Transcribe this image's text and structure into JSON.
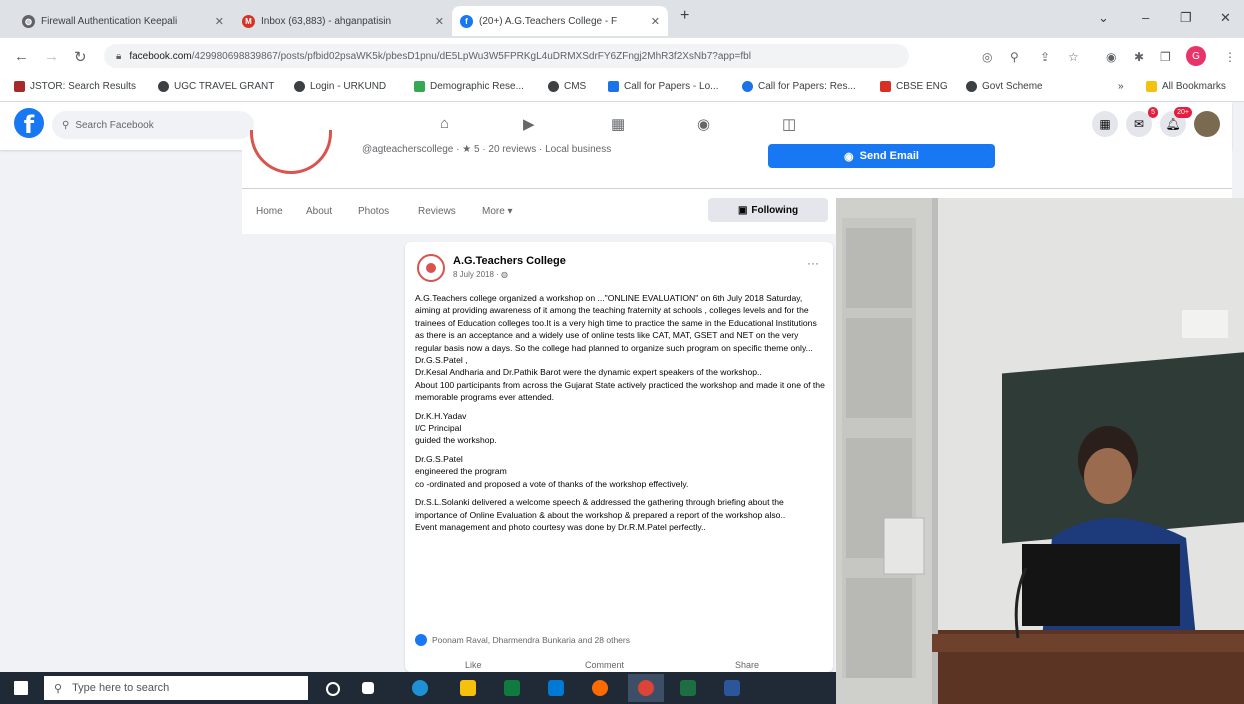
{
  "browser": {
    "tabs": [
      {
        "label": "Firewall Authentication Keepali",
        "color": "#5f6368"
      },
      {
        "label": "Inbox (63,883) - ahganpatisin",
        "color": "#d93025"
      },
      {
        "label": "(20+) A.G.Teachers College - F",
        "color": "#1877f2"
      }
    ],
    "new_tab": "+",
    "window_controls": {
      "minimize": "–",
      "restore": "❐",
      "close": "✕"
    },
    "url_domain": "facebook.com",
    "url_rest": "/429980698839867/posts/pfbid02psaWK5k/pbesD1pnu/dE5LpWu3W5FPRKgL4uDRMXSdrFY6ZFngj2MhR3f2XsNb7?app=fbl",
    "bookmarks": [
      {
        "label": "JSTOR: Search Results",
        "color": "#a52a2a"
      },
      {
        "label": "UGC TRAVEL GRANT",
        "color": "#3c4043"
      },
      {
        "label": "Login - URKUND",
        "color": "#3c4043"
      },
      {
        "label": "Demographic Rese...",
        "color": "#34a853"
      },
      {
        "label": "CMS",
        "color": "#3c4043"
      },
      {
        "label": "Call for Papers - Lo...",
        "color": "#1a73e8"
      },
      {
        "label": "Call for Papers: Res...",
        "color": "#1a73e8"
      },
      {
        "label": "CBSE ENG",
        "color": "#d93025"
      },
      {
        "label": "Govt Scheme",
        "color": "#3c4043"
      }
    ],
    "all_bookmarks": "All Bookmarks",
    "profile_initial": "G"
  },
  "facebook": {
    "search_placeholder": "Search Facebook",
    "messenger_badge": "5",
    "notif_badge": "20+",
    "page_meta": "@agteacherscollege · ★ 5 · 20 reviews · Local business",
    "send_email": "Send Email",
    "page_tabs": [
      "Home",
      "About",
      "Photos",
      "Reviews",
      "More ▾"
    ],
    "following": "Following"
  },
  "post": {
    "author": "A.G.Teachers College",
    "date": "8 July 2018 · ◍",
    "more": "···",
    "paragraphs": [
      "A.G.Teachers college organized a workshop on ...\"ONLINE EVALUATION\" on 6th July 2018 Saturday, aiming at providing awareness of it among the teaching fraternity at schools , colleges levels and for the trainees of Education colleges too.It is a very high time to practice the same in the Educational Institutions as there is an acceptance and a widely use of online tests like CAT, MAT, GSET and NET on the very regular basis now a days. So the college had planned to organize such program on specific theme only...",
      "Dr.G.S.Patel ,",
      "Dr.Kesal Andharia and Dr.Pathik Barot were the dynamic expert speakers of the workshop..",
      "About 100 participants from across the Gujarat State actively practiced the workshop and made it one of the memorable programs ever attended.",
      "",
      "Dr.K.H.Yadav",
      " I/C Principal",
      " guided the workshop.",
      "",
      "Dr.G.S.Patel",
      "engineered the program",
      " co -ordinated and proposed a vote of thanks of the workshop effectively.",
      "",
      "Dr.S.L.Solanki delivered a welcome speech & addressed the gathering through briefing about the importance of Online Evaluation & about the workshop & prepared a report of the workshop also..",
      "Event management and photo courtesy was done by Dr.R.M.Patel perfectly.."
    ],
    "reactions": "Poonam Raval, Dharmendra Bunkaria and 28 others",
    "actions": [
      "Like",
      "Comment",
      "Share"
    ]
  },
  "taskbar": {
    "search_placeholder": "Type here to search"
  },
  "colors": {
    "fb_blue": "#1877f2",
    "chrome_tabbar": "#dee1e6",
    "taskbar": "#1f2a36",
    "college_red": "#d9534f"
  }
}
